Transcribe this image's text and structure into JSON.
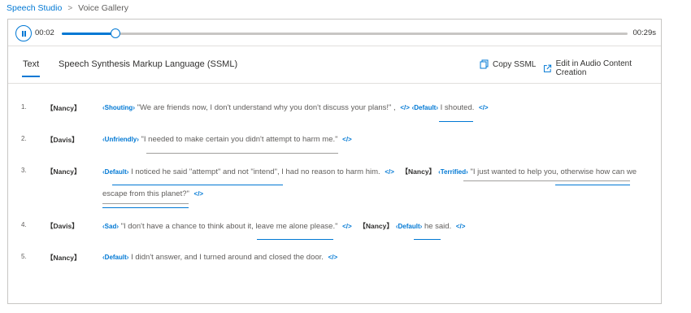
{
  "breadcrumb": {
    "root": "Speech Studio",
    "current": "Voice Gallery"
  },
  "player": {
    "current_time": "00:02",
    "total_time": "00:29s",
    "progress": 0.095
  },
  "tabs": [
    {
      "label": "Text",
      "active": true
    },
    {
      "label": "Speech Synthesis Markup Language (SSML)",
      "active": false
    }
  ],
  "actions": {
    "copy": "Copy SSML",
    "edit": "Edit in Audio Content Creation"
  },
  "accent_color": "#0078d4",
  "lines": [
    {
      "num": "1.",
      "speaker": "【Nancy】",
      "tag1": "‹Shouting›",
      "text1": "\"We are friends now, I don't understand why you don't discuss your plans!\" ,",
      "tag2": "‹Default›",
      "text2": "I shouted."
    },
    {
      "num": "2.",
      "speaker": "【Davis】",
      "tag1": "‹Unfriendly›",
      "text1": "\"I needed to make certain you didn't attempt to harm me.\""
    },
    {
      "num": "3.",
      "speaker": "【Nancy】",
      "tag1": "‹Default›",
      "text1": "I noticed he said \"attempt\" and not \"intend\", I had no reason to harm him.",
      "speaker2": "【Nancy】",
      "tag2": "‹Terrified›",
      "text2a": "\"I just wanted to help you, otherwise how can we",
      "text2b": "escape from this planet?\""
    },
    {
      "num": "4.",
      "speaker": "【Davis】",
      "tag1": "‹Sad›",
      "text1": "\"I don't have a chance to think about it, leave me alone please.\"",
      "speaker2": "【Nancy】",
      "tag2": "‹Default›",
      "text2": "he said."
    },
    {
      "num": "5.",
      "speaker": "【Nancy】",
      "tag1": "‹Default›",
      "text1": "I didn't answer, and I turned around and closed the door."
    }
  ],
  "icons": {
    "pause": "pause-icon",
    "copy": "copy-icon",
    "edit": "open-external-icon",
    "end_tag": "code-tag-icon"
  }
}
